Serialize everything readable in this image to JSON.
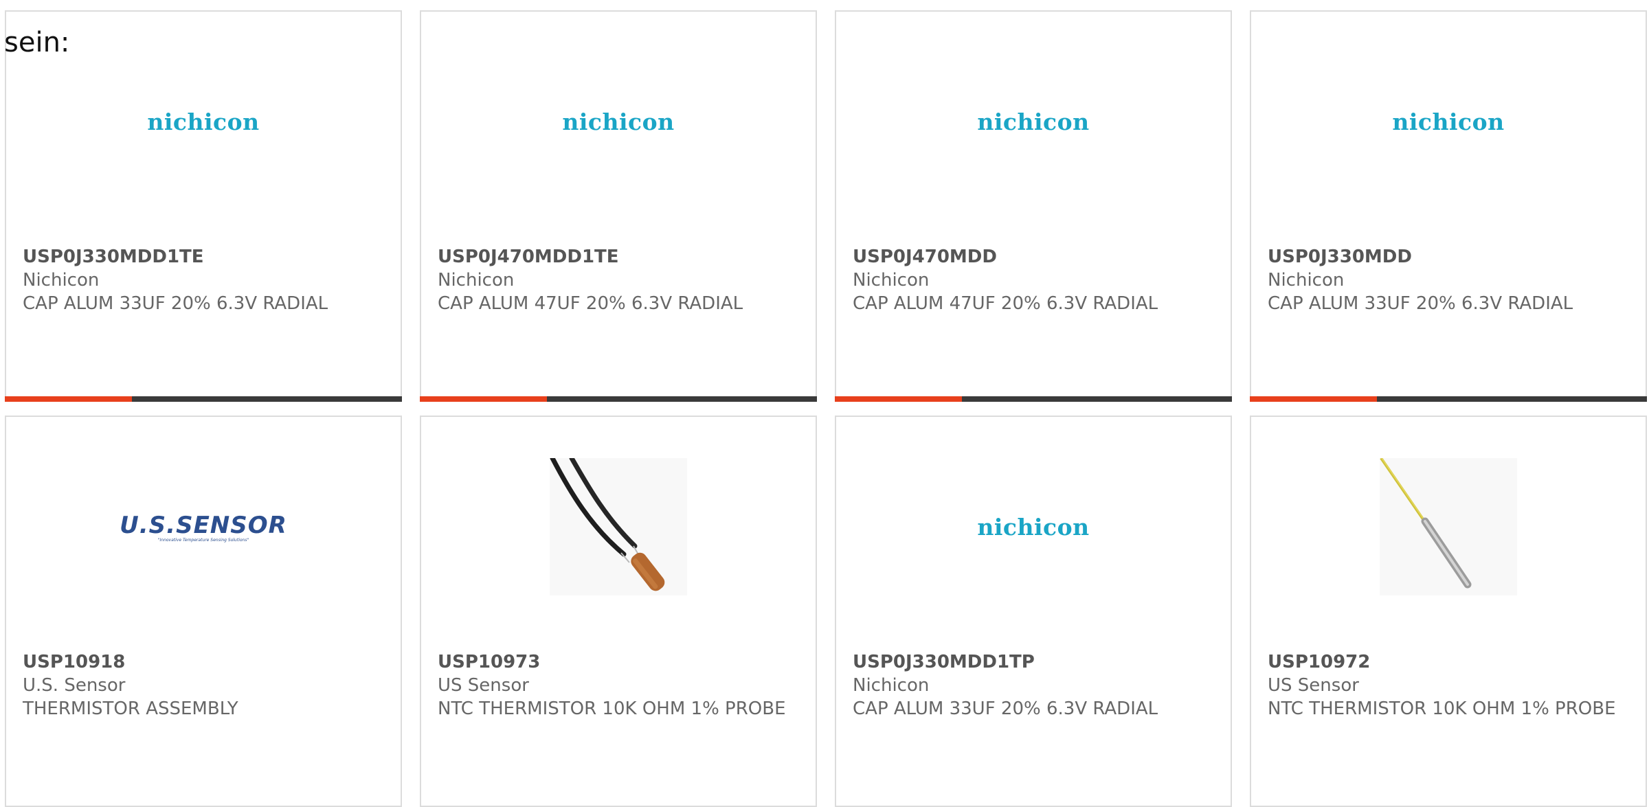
{
  "intro_text": "sein:",
  "products": [
    {
      "part": "USP0J330MDD1TE",
      "maker": "Nichicon",
      "desc": "CAP ALUM 33UF 20% 6.3V RADIAL",
      "logo": "nichicon"
    },
    {
      "part": "USP0J470MDD1TE",
      "maker": "Nichicon",
      "desc": "CAP ALUM 47UF 20% 6.3V RADIAL",
      "logo": "nichicon"
    },
    {
      "part": "USP0J470MDD",
      "maker": "Nichicon",
      "desc": "CAP ALUM 47UF 20% 6.3V RADIAL",
      "logo": "nichicon"
    },
    {
      "part": "USP0J330MDD",
      "maker": "Nichicon",
      "desc": "CAP ALUM 33UF 20% 6.3V RADIAL",
      "logo": "nichicon"
    },
    {
      "part": "USP10918",
      "maker": "U.S. Sensor",
      "desc": "THERMISTOR ASSEMBLY",
      "logo": "U.S.SENSOR",
      "logo_tagline": "\"Innovative Temperature Sensing Solutions\""
    },
    {
      "part": "USP10973",
      "maker": "US Sensor",
      "desc": "NTC THERMISTOR 10K OHM 1% PROBE",
      "image": "thermistor-probe-copper-photo"
    },
    {
      "part": "USP0J330MDD1TP",
      "maker": "Nichicon",
      "desc": "CAP ALUM 33UF 20% 6.3V RADIAL",
      "logo": "nichicon"
    },
    {
      "part": "USP10972",
      "maker": "US Sensor",
      "desc": "NTC THERMISTOR 10K OHM 1% PROBE",
      "image": "thermistor-probe-steel-photo"
    }
  ],
  "colors": {
    "accent": "#e8401c",
    "bar": "#3a3a3a",
    "nichicon_logo": "#1aa5c6",
    "usensor_logo": "#2c4f8f",
    "text": "#666666"
  },
  "bar_fill_fraction": 0.32
}
